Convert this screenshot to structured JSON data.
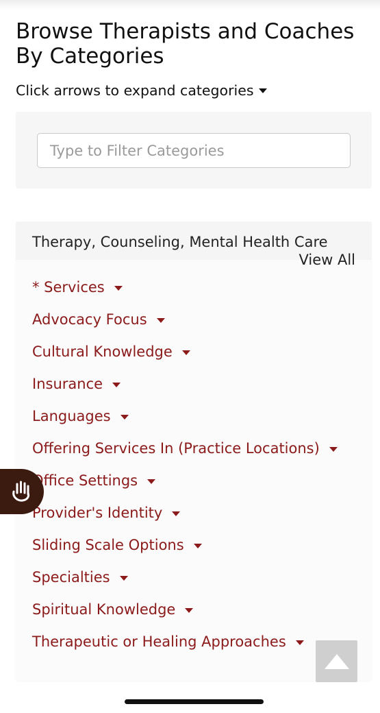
{
  "header": {
    "title": "Browse Therapists and Coaches By Categories",
    "instructions": "Click arrows to expand categories"
  },
  "filter": {
    "placeholder": "Type to Filter Categories",
    "value": ""
  },
  "section": {
    "title": "Therapy, Counseling, Mental Health Care",
    "view_all": "View All",
    "categories": [
      "* Services",
      "Advocacy Focus",
      "Cultural Knowledge",
      "Insurance",
      "Languages",
      "Offering Services In (Practice Locations)",
      "Office Settings",
      "Provider's Identity",
      "Sliding Scale Options",
      "Specialties",
      "Spiritual Knowledge",
      "Therapeutic or Healing Approaches"
    ]
  },
  "icons": {
    "accessibility": "hand-wave-icon",
    "scroll_top": "arrow-up-icon",
    "expand": "caret-down-icon"
  },
  "colors": {
    "category_link": "#8b1a1a",
    "accessibility_bg": "#3b1a10",
    "scroll_top_bg": "#cfcfcf"
  }
}
